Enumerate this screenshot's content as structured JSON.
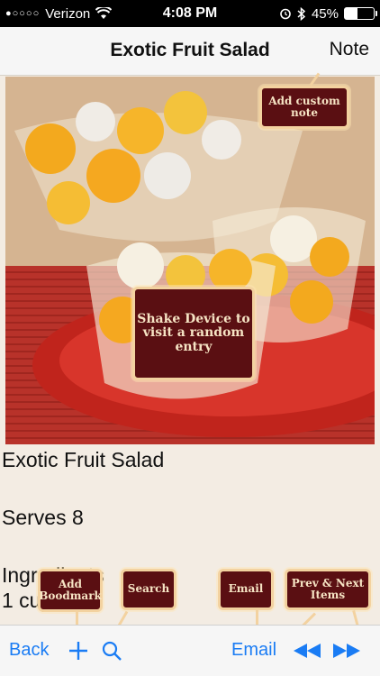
{
  "status_bar": {
    "carrier": "Verizon",
    "signal_dots": "●○○○○",
    "time": "4:08 PM",
    "battery": "45%",
    "battery_level": 0.45
  },
  "nav": {
    "title": "Exotic Fruit Salad",
    "note_label": "Note"
  },
  "content": {
    "title": "Exotic Fruit Salad",
    "serves": "Serves 8",
    "ingredients_partial": "Ingredients",
    "line1_partial": "1 cup ...",
    "line2_partial": ""
  },
  "tips": {
    "add_note": "Add custom note",
    "shake": "Shake Device to visit a random entry",
    "bookmark": "Add Boodmark",
    "search": "Search",
    "email": "Email",
    "prev_next": "Prev & Next Items"
  },
  "toolbar": {
    "back_label": "Back",
    "email_label": "Email",
    "add_icon": "plus-icon",
    "search_icon": "magnifier-icon",
    "prev_icon": "rewind-icon",
    "next_icon": "fast-forward-icon"
  },
  "colors": {
    "accent": "#1a7cf4",
    "tip_bg": "#5a0f12",
    "tip_border": "#f3d2a0",
    "page_bg": "#f3ece3"
  }
}
